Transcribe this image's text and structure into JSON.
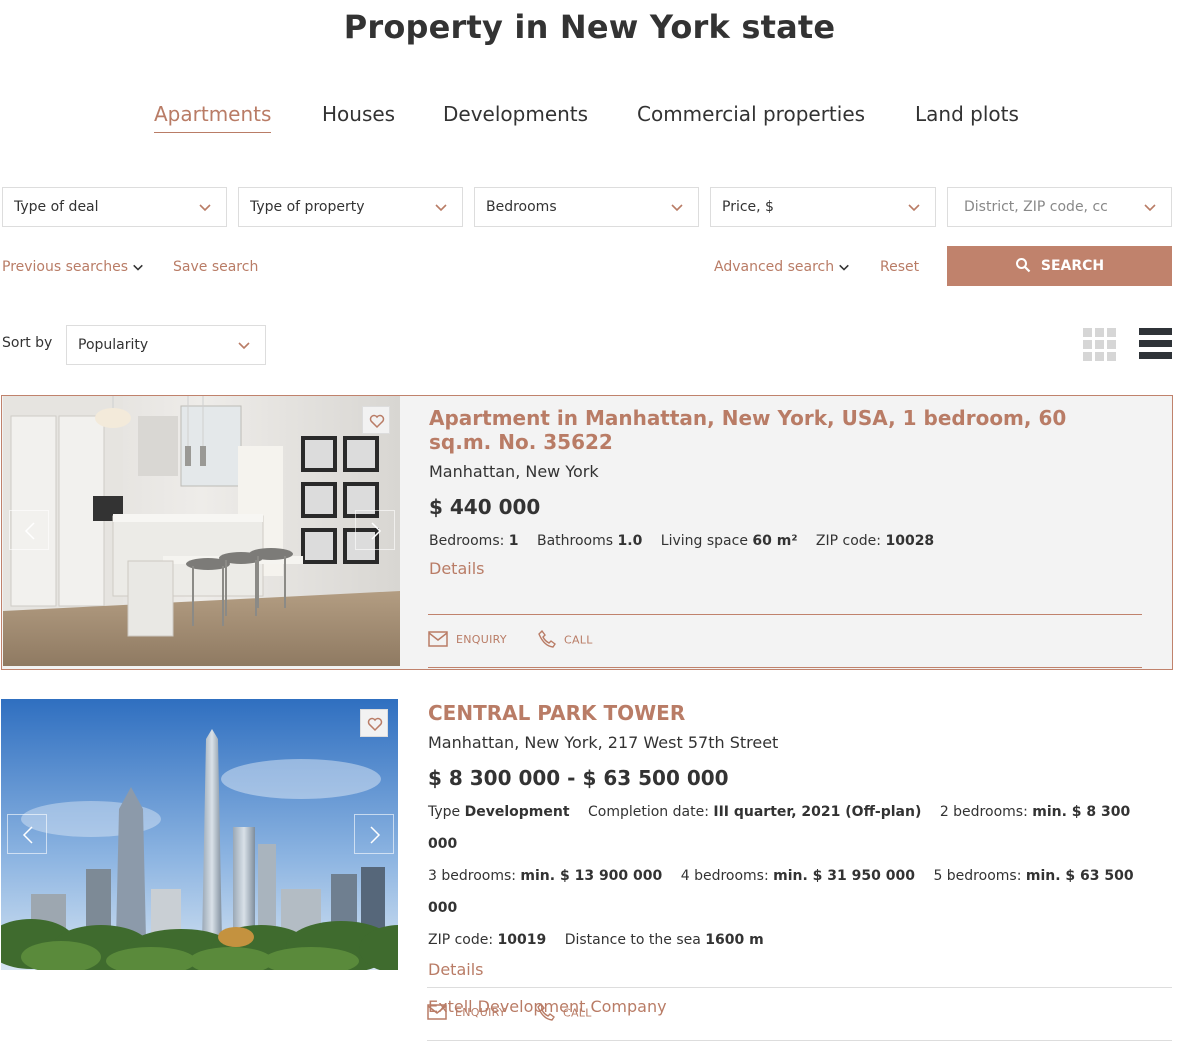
{
  "page": {
    "title": "Property in New York state"
  },
  "tabs": [
    {
      "label": "Apartments",
      "active": true
    },
    {
      "label": "Houses"
    },
    {
      "label": "Developments"
    },
    {
      "label": "Commercial properties"
    },
    {
      "label": "Land plots"
    }
  ],
  "filters": {
    "deal": "Type of deal",
    "property": "Type of property",
    "bedrooms": "Bedrooms",
    "price": "Price, $",
    "location_placeholder": "District, ZIP code, cc"
  },
  "links": {
    "previous_searches": "Previous searches",
    "save_search": "Save search",
    "advanced_search": "Advanced search",
    "reset": "Reset",
    "search": "SEARCH"
  },
  "sort": {
    "label": "Sort by",
    "value": "Popularity"
  },
  "colors": {
    "accent": "#b97c66",
    "button": "#c0826c",
    "card_bg": "#f3f3f3"
  },
  "listings": [
    {
      "title": "Apartment in Manhattan, New York, USA, 1 bedroom, 60 sq.m. No. 35622",
      "location": "Manhattan, New York",
      "price": "$ 440 000",
      "props": [
        {
          "k": "Bedrooms: ",
          "v": "1"
        },
        {
          "k": "Bathrooms ",
          "v": "1.0"
        },
        {
          "k": "Living space ",
          "v": "60 m²"
        },
        {
          "k": "ZIP code: ",
          "v": "10028"
        }
      ],
      "details": "Details",
      "enquiry": "ENQUIRY",
      "call": "CALL"
    },
    {
      "title": "CENTRAL PARK TOWER",
      "location": "Manhattan, New York, 217 West 57th Street",
      "price": "$ 8 300 000 - $ 63 500 000",
      "props_row1": [
        {
          "k": "Type ",
          "v": "Development"
        },
        {
          "k": "Completion date: ",
          "v": "III quarter, 2021 (Off-plan)"
        },
        {
          "k": "2 bedrooms: ",
          "v": "min. $ 8 300 000"
        }
      ],
      "props_row2": [
        {
          "k": "3 bedrooms: ",
          "v": "min. $ 13 900 000"
        },
        {
          "k": "4 bedrooms: ",
          "v": "min. $ 31 950 000"
        },
        {
          "k": "5 bedrooms: ",
          "v": "min. $ 63 500 000"
        }
      ],
      "props_row3": [
        {
          "k": "ZIP code: ",
          "v": "10019"
        },
        {
          "k": "Distance to the sea ",
          "v": "1600 m"
        }
      ],
      "details": "Details",
      "developer": "Extell Development Company",
      "enquiry": "ENQUIRY",
      "call": "CALL"
    }
  ]
}
